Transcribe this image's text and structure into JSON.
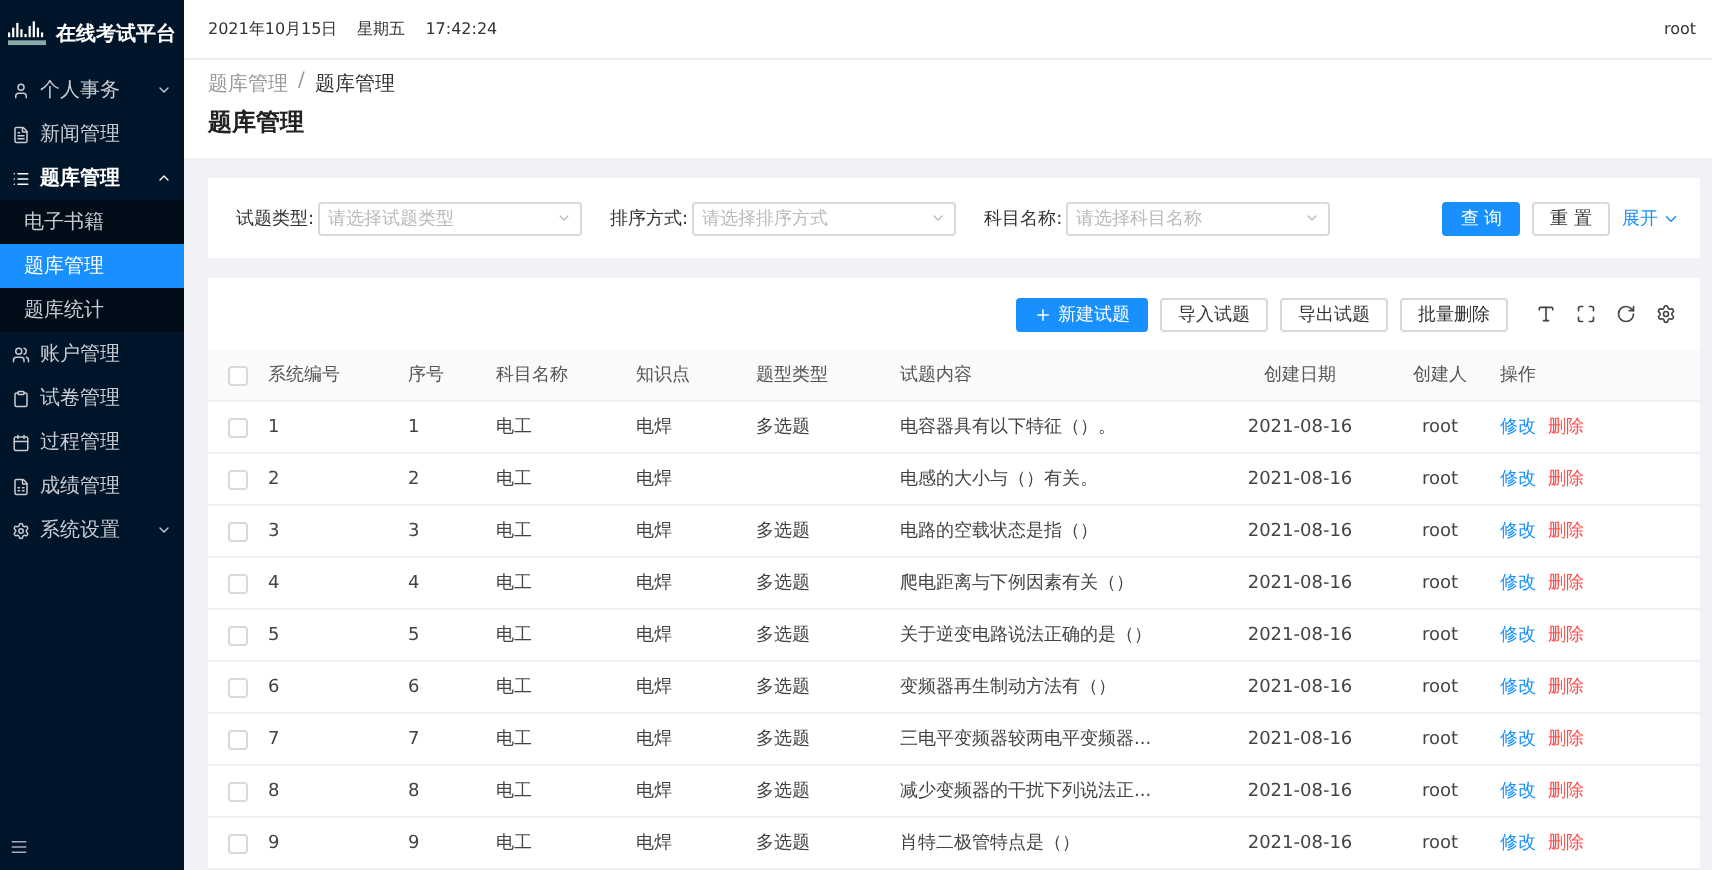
{
  "sidebar": {
    "title": "在线考试平台",
    "items": [
      {
        "label": "个人事务",
        "expanded": false
      },
      {
        "label": "新闻管理"
      },
      {
        "label": "题库管理",
        "expanded": true,
        "children": [
          {
            "label": "电子书籍",
            "selected": false
          },
          {
            "label": "题库管理",
            "selected": true
          },
          {
            "label": "题库统计",
            "selected": false
          }
        ]
      },
      {
        "label": "账户管理"
      },
      {
        "label": "试卷管理"
      },
      {
        "label": "过程管理"
      },
      {
        "label": "成绩管理"
      },
      {
        "label": "系统设置",
        "expanded": false
      }
    ]
  },
  "header": {
    "date": "2021年10月15日",
    "weekday": "星期五",
    "time": "17:42:24",
    "user": "root"
  },
  "breadcrumb": [
    "题库管理",
    "题库管理"
  ],
  "breadcrumb_separator": "/",
  "page_title": "题库管理",
  "filters": [
    {
      "label": "试题类型:",
      "placeholder": "请选择试题类型"
    },
    {
      "label": "排序方式:",
      "placeholder": "请选择排序方式"
    },
    {
      "label": "科目名称:",
      "placeholder": "请选择科目名称"
    }
  ],
  "filter_buttons": [
    {
      "label": "查 询",
      "kind": "primary"
    },
    {
      "label": "重 置",
      "kind": "default"
    }
  ],
  "expand_link": "展开",
  "toolbar_buttons": [
    {
      "label": "新建试题",
      "kind": "primary"
    },
    {
      "label": "导入试题",
      "kind": "default"
    },
    {
      "label": "导出试题",
      "kind": "default"
    },
    {
      "label": "批量删除",
      "kind": "default"
    }
  ],
  "table": {
    "columns": [
      "系统编号",
      "序号",
      "科目名称",
      "知识点",
      "题型类型",
      "试题内容",
      "创建日期",
      "创建人",
      "操作"
    ],
    "header_checked": false,
    "rows": [
      {
        "checked": false,
        "cells": [
          "1",
          "1",
          "电工",
          "电焊",
          "多选题",
          "电容器具有以下特征（）。",
          "2021-08-16",
          "root"
        ],
        "actions": [
          "修改",
          "删除"
        ]
      },
      {
        "checked": false,
        "cells": [
          "2",
          "2",
          "电工",
          "电焊",
          "",
          "电感的大小与（）有关。",
          "2021-08-16",
          "root"
        ],
        "actions": [
          "修改",
          "删除"
        ]
      },
      {
        "checked": false,
        "cells": [
          "3",
          "3",
          "电工",
          "电焊",
          "多选题",
          "电路的空载状态是指（）",
          "2021-08-16",
          "root"
        ],
        "actions": [
          "修改",
          "删除"
        ]
      },
      {
        "checked": false,
        "cells": [
          "4",
          "4",
          "电工",
          "电焊",
          "多选题",
          "爬电距离与下例因素有关（）",
          "2021-08-16",
          "root"
        ],
        "actions": [
          "修改",
          "删除"
        ]
      },
      {
        "checked": false,
        "cells": [
          "5",
          "5",
          "电工",
          "电焊",
          "多选题",
          "关于逆变电路说法正确的是（）",
          "2021-08-16",
          "root"
        ],
        "actions": [
          "修改",
          "删除"
        ]
      },
      {
        "checked": false,
        "cells": [
          "6",
          "6",
          "电工",
          "电焊",
          "多选题",
          "变频器再生制动方法有（）",
          "2021-08-16",
          "root"
        ],
        "actions": [
          "修改",
          "删除"
        ]
      },
      {
        "checked": false,
        "cells": [
          "7",
          "7",
          "电工",
          "电焊",
          "多选题",
          "三电平变频器较两电平变频器...",
          "2021-08-16",
          "root"
        ],
        "actions": [
          "修改",
          "删除"
        ]
      },
      {
        "checked": false,
        "cells": [
          "8",
          "8",
          "电工",
          "电焊",
          "多选题",
          "减少变频器的干扰下列说法正...",
          "2021-08-16",
          "root"
        ],
        "actions": [
          "修改",
          "删除"
        ]
      },
      {
        "checked": false,
        "cells": [
          "9",
          "9",
          "电工",
          "电焊",
          "多选题",
          "肖特二极管特点是（）",
          "2021-08-16",
          "root"
        ],
        "actions": [
          "修改",
          "删除"
        ]
      }
    ]
  }
}
